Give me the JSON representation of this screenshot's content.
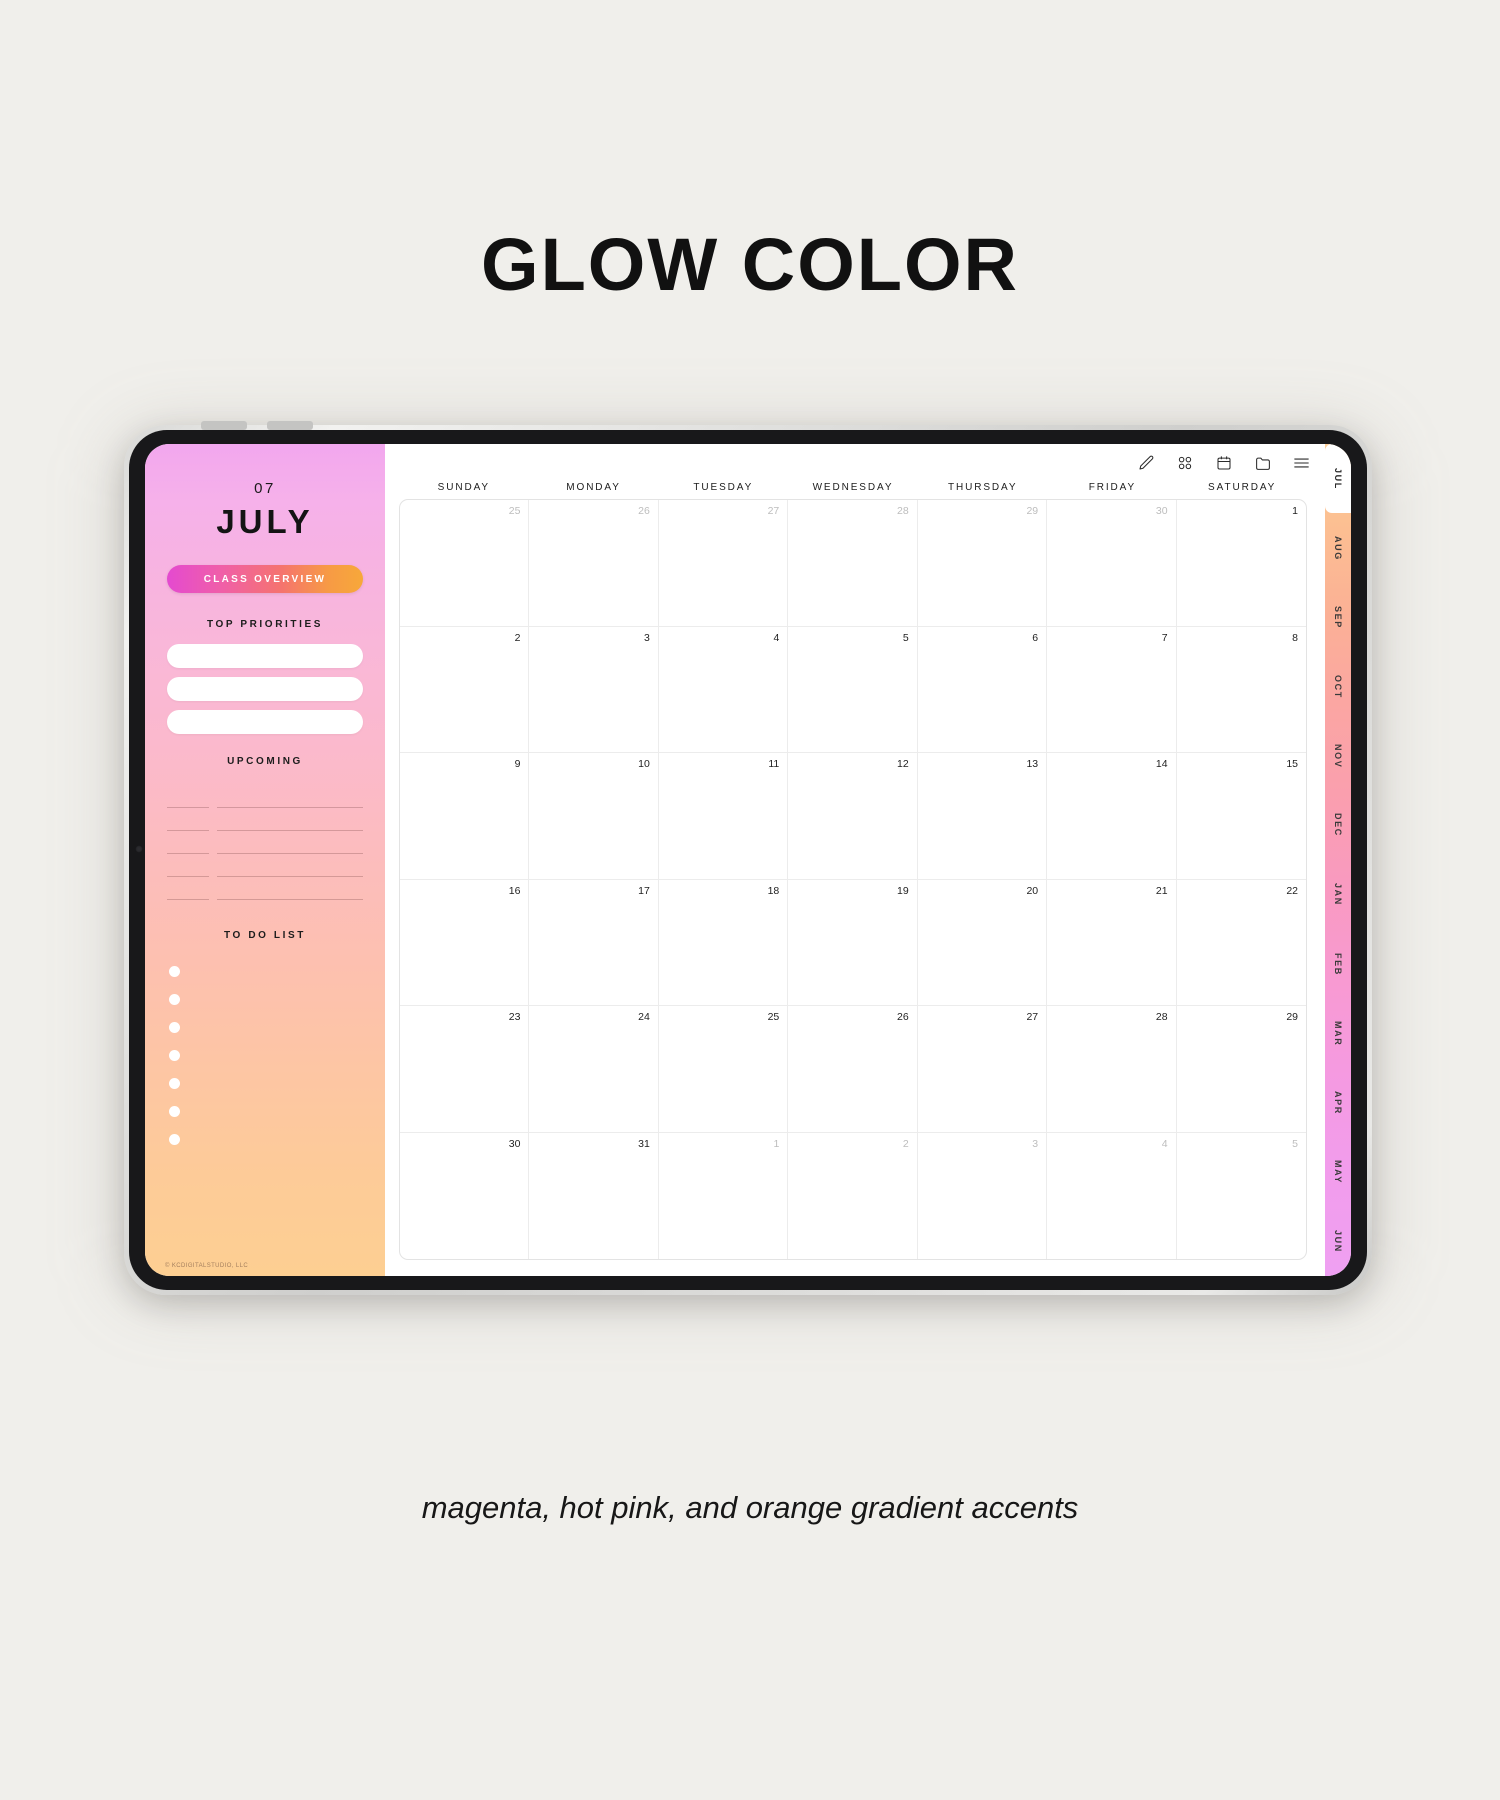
{
  "page": {
    "title": "GLOW COLOR",
    "caption": "magenta, hot pink, and orange gradient accents"
  },
  "sidebar": {
    "month_number": "07",
    "month_name": "JULY",
    "class_overview_label": "CLASS OVERVIEW",
    "top_priorities_label": "TOP PRIORITIES",
    "top_priorities_items": [
      "",
      "",
      ""
    ],
    "upcoming_label": "UPCOMING",
    "upcoming_rows": [
      "",
      "",
      "",
      "",
      ""
    ],
    "todo_label": "TO DO LIST",
    "todo_items": [
      "",
      "",
      "",
      "",
      "",
      "",
      ""
    ],
    "copyright": "© KCDIGITALSTUDIO, LLC"
  },
  "toolbar": {
    "icons": [
      {
        "name": "pencil-icon",
        "label": "pencil"
      },
      {
        "name": "grid-icon",
        "label": "grid"
      },
      {
        "name": "calendar-icon",
        "label": "calendar"
      },
      {
        "name": "folder-icon",
        "label": "folder"
      },
      {
        "name": "menu-icon",
        "label": "menu"
      }
    ]
  },
  "calendar": {
    "weekdays": [
      "SUNDAY",
      "MONDAY",
      "TUESDAY",
      "WEDNESDAY",
      "THURSDAY",
      "FRIDAY",
      "SATURDAY"
    ],
    "cells": [
      {
        "d": "25",
        "muted": true
      },
      {
        "d": "26",
        "muted": true
      },
      {
        "d": "27",
        "muted": true
      },
      {
        "d": "28",
        "muted": true
      },
      {
        "d": "29",
        "muted": true
      },
      {
        "d": "30",
        "muted": true
      },
      {
        "d": "1",
        "muted": false
      },
      {
        "d": "2",
        "muted": false
      },
      {
        "d": "3",
        "muted": false
      },
      {
        "d": "4",
        "muted": false
      },
      {
        "d": "5",
        "muted": false
      },
      {
        "d": "6",
        "muted": false
      },
      {
        "d": "7",
        "muted": false
      },
      {
        "d": "8",
        "muted": false
      },
      {
        "d": "9",
        "muted": false
      },
      {
        "d": "10",
        "muted": false
      },
      {
        "d": "11",
        "muted": false
      },
      {
        "d": "12",
        "muted": false
      },
      {
        "d": "13",
        "muted": false
      },
      {
        "d": "14",
        "muted": false
      },
      {
        "d": "15",
        "muted": false
      },
      {
        "d": "16",
        "muted": false
      },
      {
        "d": "17",
        "muted": false
      },
      {
        "d": "18",
        "muted": false
      },
      {
        "d": "19",
        "muted": false
      },
      {
        "d": "20",
        "muted": false
      },
      {
        "d": "21",
        "muted": false
      },
      {
        "d": "22",
        "muted": false
      },
      {
        "d": "23",
        "muted": false
      },
      {
        "d": "24",
        "muted": false
      },
      {
        "d": "25",
        "muted": false
      },
      {
        "d": "26",
        "muted": false
      },
      {
        "d": "27",
        "muted": false
      },
      {
        "d": "28",
        "muted": false
      },
      {
        "d": "29",
        "muted": false
      },
      {
        "d": "30",
        "muted": false
      },
      {
        "d": "31",
        "muted": false
      },
      {
        "d": "1",
        "muted": true
      },
      {
        "d": "2",
        "muted": true
      },
      {
        "d": "3",
        "muted": true
      },
      {
        "d": "4",
        "muted": true
      },
      {
        "d": "5",
        "muted": true
      }
    ]
  },
  "month_tabs": {
    "active": "JUL",
    "items": [
      "JUL",
      "AUG",
      "SEP",
      "OCT",
      "NOV",
      "DEC",
      "JAN",
      "FEB",
      "MAR",
      "APR",
      "MAY",
      "JUN"
    ]
  },
  "colors": {
    "page_background": "#f0efeb",
    "accent_magenta": "#e44ad0",
    "accent_hot_pink": "#f05fa8",
    "accent_orange": "#f7a83a",
    "sidebar_top": "#f2a7ee",
    "sidebar_bottom": "#fdcf92",
    "bezel": "#18181a"
  }
}
